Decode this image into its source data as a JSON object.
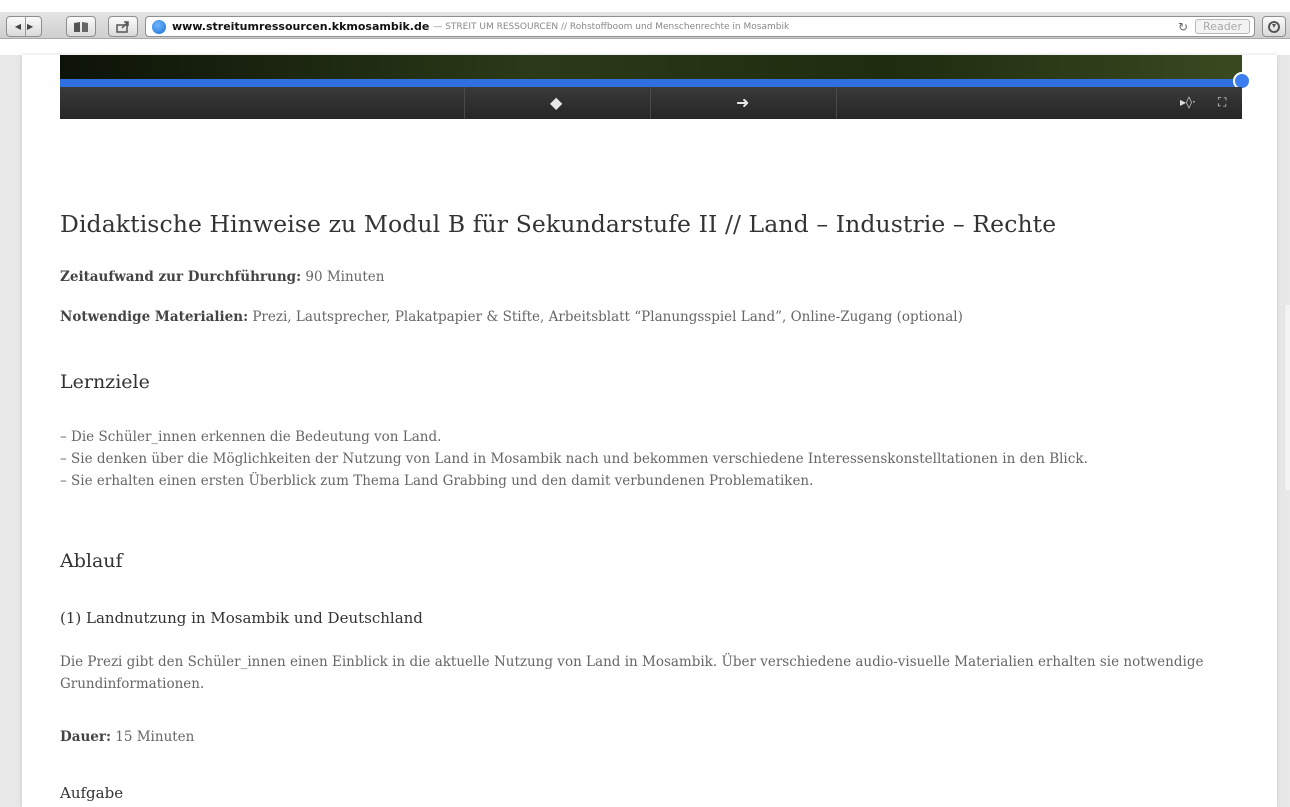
{
  "browser": {
    "url": "www.streitumressourcen.kkmosambik.de",
    "title": "— STREIT UM RESSOURCEN // Rohstoffboom und Menschenrechte in Mosambik",
    "reader_label": "Reader",
    "reload_icon": "↻",
    "back_icon": "◀",
    "forward_icon": "▶"
  },
  "video": {
    "progress_percent": 100,
    "prev_icon": "◆",
    "next_icon": "➜",
    "volume_icon": "▸◊·",
    "fullscreen_icon": "⛶"
  },
  "main": {
    "title": "Didaktische Hinweise zu Modul B für Sekundarstufe II // Land – Industrie – Rechte",
    "time_label": "Zeitaufwand zur Durchführung:",
    "time_value": " 90 Minuten",
    "materials_label": "Notwendige Materialien:",
    "materials_value": " Prezi, Lautsprecher, Plakatpapier & Stifte, Arbeitsblatt “Planungsspiel Land”, Online-Zugang (optional)",
    "goals_heading": "Lernziele",
    "goals": [
      "– Die Schüler_innen erkennen die Bedeutung von Land.",
      "– Sie denken über die Möglichkeiten der Nutzung von Land in Mosambik nach und bekommen verschiedene Interessenskonstelltationen in den Blick.",
      "– Sie erhalten einen ersten Überblick zum Thema Land Grabbing und den damit verbundenen Problematiken."
    ],
    "process_heading": "Ablauf",
    "step1_heading": "(1) Landnutzung in Mosambik und Deutschland",
    "step1_text": "Die Prezi gibt den Schüler_innen einen Einblick in die aktuelle Nutzung von Land in Mosambik. Über verschiedene audio-visuelle Materialien erhalten sie notwendige Grundinformationen.",
    "duration_label": "Dauer:",
    "duration_value": " 15 Minuten",
    "task_heading": "Aufgabe"
  }
}
